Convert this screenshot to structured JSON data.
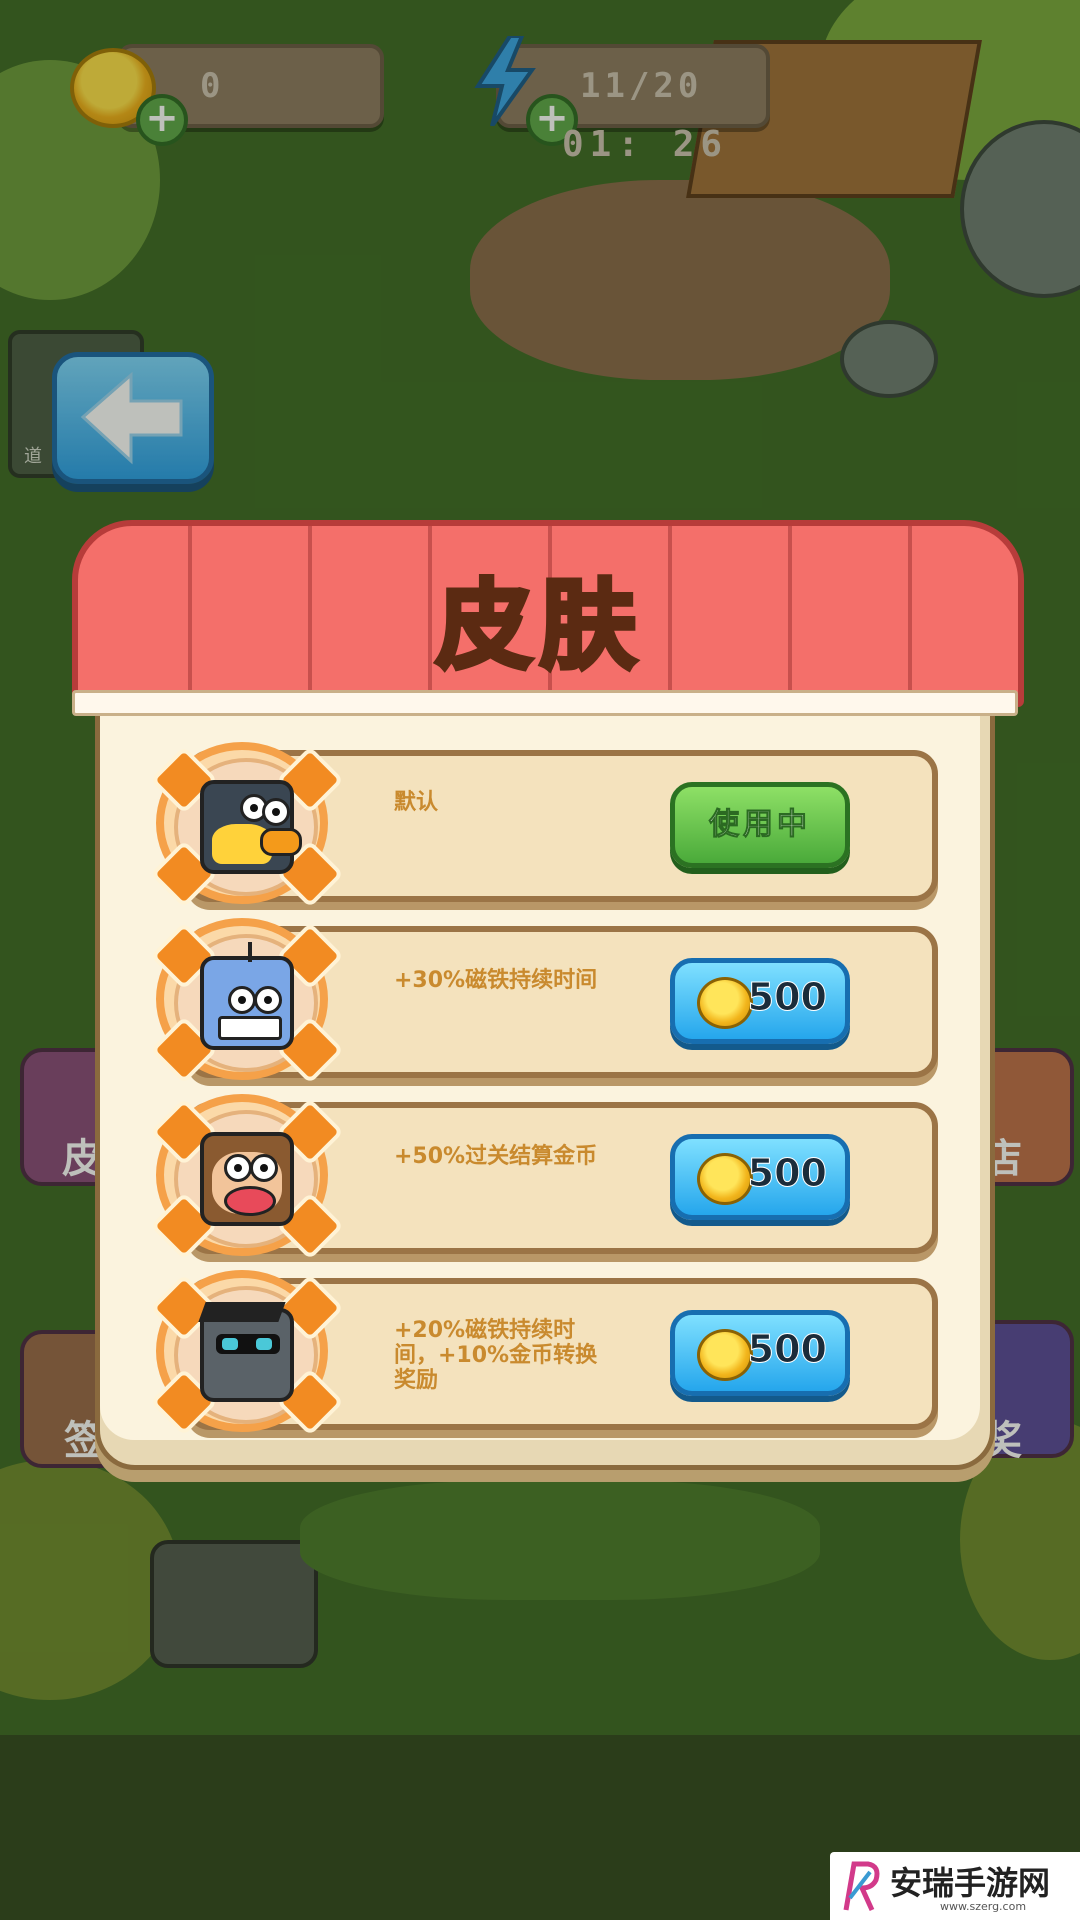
{
  "hud": {
    "coins": "0",
    "energy": "11/20",
    "timer": "01: 26",
    "side_label_left": "道"
  },
  "panel": {
    "title": "皮肤"
  },
  "skins": [
    {
      "description": "默认",
      "button_type": "in_use",
      "button_label": "使用中",
      "character": "penguin-duck-icon"
    },
    {
      "description": "+30%磁铁持续时间",
      "button_type": "price",
      "price": "500",
      "character": "shark-icon"
    },
    {
      "description": "+50%过关结算金币",
      "button_type": "price",
      "price": "500",
      "character": "monkey-icon"
    },
    {
      "description": "+20%磁铁持续时间，+10%金币转换奖励",
      "button_type": "price",
      "price": "500",
      "character": "cool-robot-icon"
    }
  ],
  "side_labels": {
    "left_top": "皮",
    "left_bottom": "签",
    "right_top": "店",
    "right_bottom": "奖"
  },
  "watermark": {
    "title": "安瑞手游网",
    "url": "www.szerg.com"
  },
  "colors": {
    "awning": "#f46f6a",
    "panel": "#fbf3de",
    "button_green": "#4aaa3a",
    "button_blue": "#25a6ec",
    "title_text": "#ffd84a"
  }
}
